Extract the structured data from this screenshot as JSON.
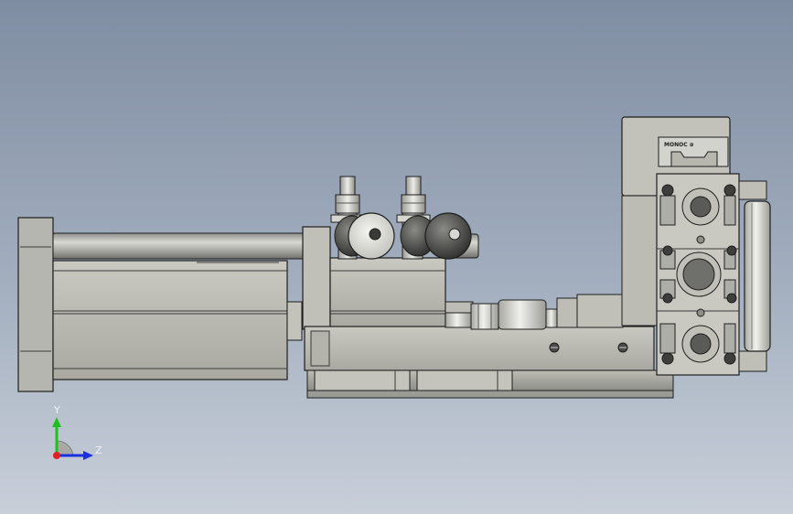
{
  "model": {
    "plate_label": "MONOC ⊕"
  },
  "triad": {
    "y_label": "Y",
    "z_label": "Z"
  }
}
